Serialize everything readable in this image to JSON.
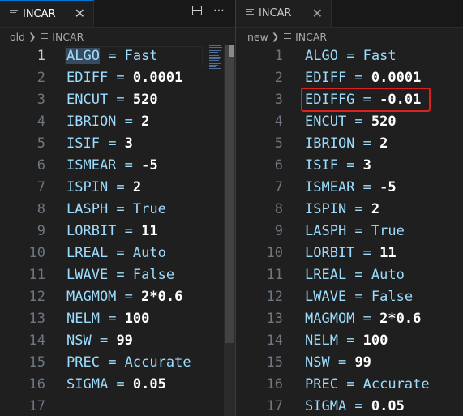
{
  "left": {
    "tab_label": "INCAR",
    "tab_close": "✕",
    "breadcrumb": [
      "old",
      "INCAR"
    ],
    "lines": [
      {
        "n": "1",
        "key": "ALGO",
        "val": "Fast",
        "type": "val"
      },
      {
        "n": "2",
        "key": "EDIFF",
        "val": "0.0001",
        "type": "num"
      },
      {
        "n": "3",
        "key": "ENCUT",
        "val": "520",
        "type": "num"
      },
      {
        "n": "4",
        "key": "IBRION",
        "val": "2",
        "type": "num"
      },
      {
        "n": "5",
        "key": "ISIF",
        "val": "3",
        "type": "num"
      },
      {
        "n": "6",
        "key": "ISMEAR",
        "val": "-5",
        "type": "num"
      },
      {
        "n": "7",
        "key": "ISPIN",
        "val": "2",
        "type": "num"
      },
      {
        "n": "8",
        "key": "LASPH",
        "val": "True",
        "type": "val"
      },
      {
        "n": "9",
        "key": "LORBIT",
        "val": "11",
        "type": "num"
      },
      {
        "n": "10",
        "key": "LREAL",
        "val": "Auto",
        "type": "val"
      },
      {
        "n": "11",
        "key": "LWAVE",
        "val": "False",
        "type": "val"
      },
      {
        "n": "12",
        "key": "MAGMOM",
        "val": "2*0.6",
        "type": "num"
      },
      {
        "n": "13",
        "key": "NELM",
        "val": "100",
        "type": "num"
      },
      {
        "n": "14",
        "key": "NSW",
        "val": "99",
        "type": "num"
      },
      {
        "n": "15",
        "key": "PREC",
        "val": "Accurate",
        "type": "val"
      },
      {
        "n": "16",
        "key": "SIGMA",
        "val": "0.05",
        "type": "num"
      },
      {
        "n": "17",
        "key": "",
        "val": "",
        "type": "empty"
      }
    ]
  },
  "right": {
    "tab_label": "INCAR",
    "tab_close": "✕",
    "breadcrumb": [
      "new",
      "INCAR"
    ],
    "lines": [
      {
        "n": "1",
        "key": "ALGO",
        "val": "Fast",
        "type": "val"
      },
      {
        "n": "2",
        "key": "EDIFF",
        "val": "0.0001",
        "type": "num"
      },
      {
        "n": "3",
        "key": "EDIFFG",
        "val": "-0.01",
        "type": "num"
      },
      {
        "n": "4",
        "key": "ENCUT",
        "val": "520",
        "type": "num"
      },
      {
        "n": "5",
        "key": "IBRION",
        "val": "2",
        "type": "num"
      },
      {
        "n": "6",
        "key": "ISIF",
        "val": "3",
        "type": "num"
      },
      {
        "n": "7",
        "key": "ISMEAR",
        "val": "-5",
        "type": "num"
      },
      {
        "n": "8",
        "key": "ISPIN",
        "val": "2",
        "type": "num"
      },
      {
        "n": "9",
        "key": "LASPH",
        "val": "True",
        "type": "val"
      },
      {
        "n": "10",
        "key": "LORBIT",
        "val": "11",
        "type": "num"
      },
      {
        "n": "11",
        "key": "LREAL",
        "val": "Auto",
        "type": "val"
      },
      {
        "n": "12",
        "key": "LWAVE",
        "val": "False",
        "type": "val"
      },
      {
        "n": "13",
        "key": "MAGMOM",
        "val": "2*0.6",
        "type": "num"
      },
      {
        "n": "14",
        "key": "NELM",
        "val": "100",
        "type": "num"
      },
      {
        "n": "15",
        "key": "NSW",
        "val": "99",
        "type": "num"
      },
      {
        "n": "16",
        "key": "PREC",
        "val": "Accurate",
        "type": "val"
      },
      {
        "n": "17",
        "key": "SIGMA",
        "val": "0.05",
        "type": "num"
      }
    ]
  },
  "toolbar": {
    "more_glyph": "⋯"
  },
  "colors": {
    "highlight_box": "#e0201e",
    "tab_accent": "#0078d4"
  },
  "icons": [
    "file-lines-icon",
    "close-icon",
    "split-editor-icon",
    "more-actions-icon",
    "chevron-right-icon"
  ]
}
